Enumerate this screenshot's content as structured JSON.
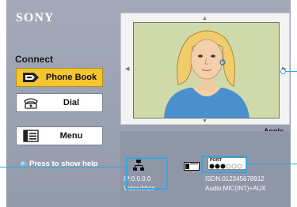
{
  "brand": "SONY",
  "connect": {
    "title": "Connect",
    "phone_book_label": "Phone Book",
    "dial_label": "Dial",
    "menu_label": "Menu"
  },
  "help_text": "Press to show help",
  "preview": {
    "angle_label": "Angle Adj."
  },
  "status": {
    "ip": "IP:0.0.0.0",
    "video": "Video:Main",
    "port_label": "PORT",
    "isdn": "ISDN:012345678912",
    "audio": "Audio:MIC(INT)+AUX"
  },
  "colors": {
    "background": "#9aa1b1",
    "active_button": "#f2c531",
    "highlight": "#36a6dc"
  },
  "icons": [
    "phone-book-icon",
    "dial-icon",
    "menu-icon",
    "help-dot-icon",
    "network-icon",
    "isdn-card-icon",
    "port-status-icon"
  ]
}
